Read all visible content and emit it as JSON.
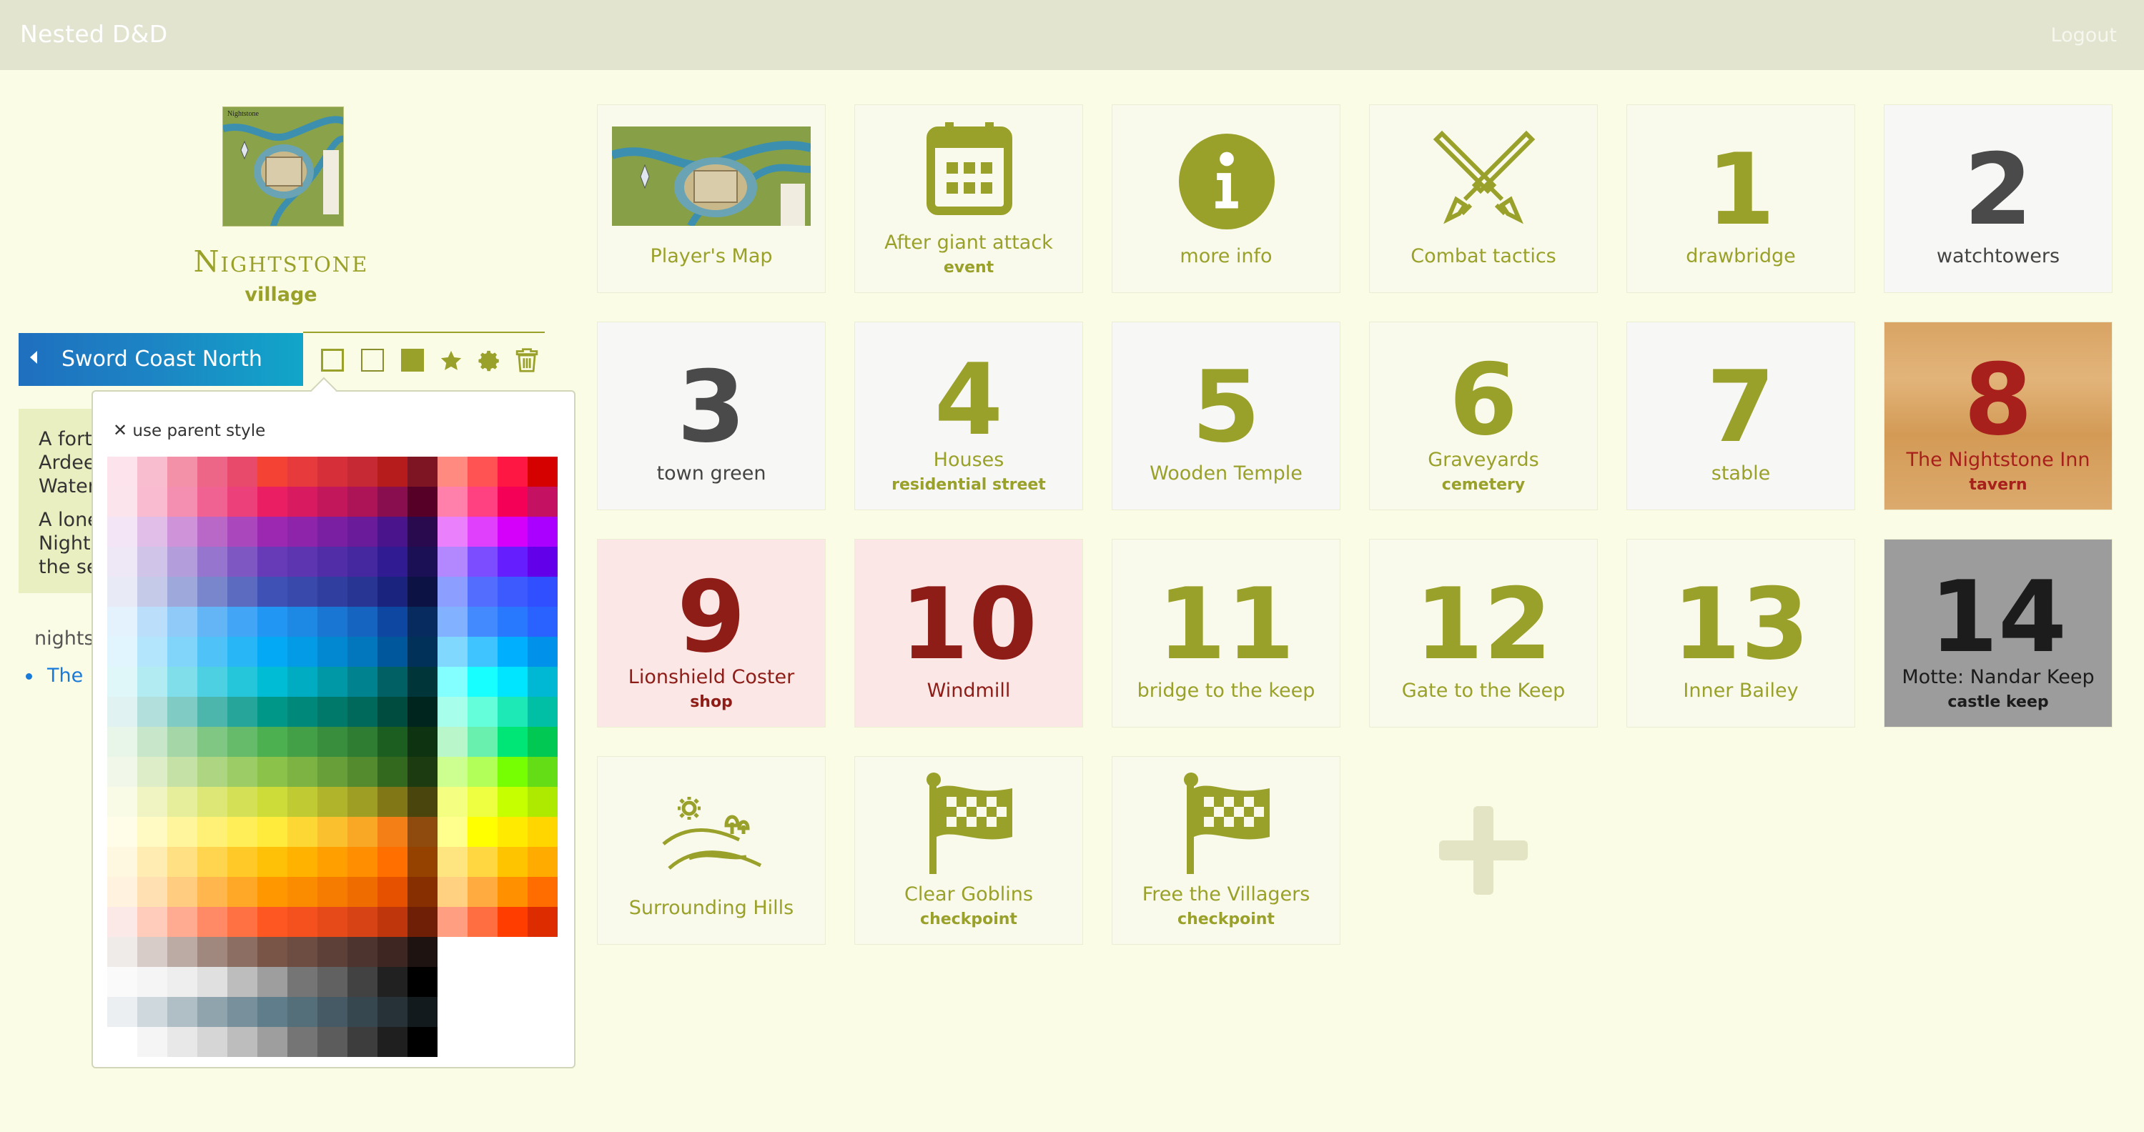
{
  "app": {
    "brand": "Nested D&D",
    "logout": "Logout"
  },
  "map": {
    "title": "Nightstone",
    "subtitle": "village",
    "thumb_text": "Nightstone"
  },
  "breadcrumb": {
    "label": "Sword Coast North"
  },
  "description": {
    "lines": [
      [
        "A forti",
        "Ardee",
        "Water"
      ],
      [
        "A lone",
        "Nights",
        "the se"
      ]
    ]
  },
  "children": {
    "label": "nightst",
    "link": "The"
  },
  "style_popup": {
    "use_parent": "use parent style"
  },
  "colors": {
    "accent": "#9aa12a",
    "link": "#1a7ad9",
    "dark_red": "#8e1c17",
    "dark_gray": "#4a4a4a"
  },
  "palette": [
    [
      "#fde4ec",
      "#f9bdd0",
      "#f391a9",
      "#ed6687",
      "#e84a6c",
      "#f44235",
      "#e63a3c",
      "#d72f3a",
      "#c62834",
      "#b71c1c",
      "#7d1622",
      "#ff8a80",
      "#ff5252",
      "#ff1744",
      "#d50000"
    ],
    [
      "#fce4ec",
      "#f8bbd0",
      "#f48fb1",
      "#f06292",
      "#ec407a",
      "#e91e63",
      "#d81b60",
      "#c2185b",
      "#ad1457",
      "#880e4f",
      "#560027",
      "#ff80ab",
      "#ff4081",
      "#f50057",
      "#c51162"
    ],
    [
      "#f3e5f5",
      "#e1bee7",
      "#ce93d8",
      "#ba68c8",
      "#ab47bc",
      "#9c27b0",
      "#8e24aa",
      "#7b1fa2",
      "#6a1b9a",
      "#4a148c",
      "#2a0a4f",
      "#ea80fc",
      "#e040fb",
      "#d500f9",
      "#aa00ff"
    ],
    [
      "#ede7f6",
      "#d1c4e9",
      "#b39ddb",
      "#9575cd",
      "#7e57c2",
      "#673ab7",
      "#5e35b1",
      "#512da8",
      "#4527a0",
      "#311b92",
      "#1b0f55",
      "#b388ff",
      "#7c4dff",
      "#651fff",
      "#6200ea"
    ],
    [
      "#e8eaf6",
      "#c5cae9",
      "#9fa8da",
      "#7986cb",
      "#5c6bc0",
      "#3f51b5",
      "#3949ab",
      "#303f9f",
      "#283593",
      "#1a237e",
      "#0d1245",
      "#8c9eff",
      "#536dfe",
      "#3d5afe",
      "#304ffe"
    ],
    [
      "#e3f2fd",
      "#bbdefb",
      "#90caf9",
      "#64b5f6",
      "#42a5f5",
      "#2196f3",
      "#1e88e5",
      "#1976d2",
      "#1565c0",
      "#0d47a1",
      "#072a5f",
      "#82b1ff",
      "#448aff",
      "#2979ff",
      "#2962ff"
    ],
    [
      "#e1f5fe",
      "#b3e5fc",
      "#81d4fa",
      "#4fc3f7",
      "#29b6f6",
      "#03a9f4",
      "#039be5",
      "#0288d1",
      "#0277bd",
      "#01579b",
      "#013058",
      "#80d8ff",
      "#40c4ff",
      "#00b0ff",
      "#0091ea"
    ],
    [
      "#e0f7fa",
      "#b2ebf2",
      "#80deea",
      "#4dd0e1",
      "#26c6da",
      "#00bcd4",
      "#00acc1",
      "#0097a7",
      "#00838f",
      "#006064",
      "#00353a",
      "#84ffff",
      "#18ffff",
      "#00e5ff",
      "#00b8d4"
    ],
    [
      "#e0f2f1",
      "#b2dfdb",
      "#80cbc4",
      "#4db6ac",
      "#26a69a",
      "#009688",
      "#00897b",
      "#00796b",
      "#00695c",
      "#004d40",
      "#00251f",
      "#a7ffeb",
      "#64ffda",
      "#1de9b6",
      "#00bfa5"
    ],
    [
      "#e8f5e9",
      "#c8e6c9",
      "#a5d6a7",
      "#81c784",
      "#66bb6a",
      "#4caf50",
      "#43a047",
      "#388e3c",
      "#2e7d32",
      "#1b5e20",
      "#0d3310",
      "#b9f6ca",
      "#69f0ae",
      "#00e676",
      "#00c853"
    ],
    [
      "#f1f8e9",
      "#dcedc8",
      "#c5e1a5",
      "#aed581",
      "#9ccc65",
      "#8bc34a",
      "#7cb342",
      "#689f38",
      "#558b2f",
      "#33691e",
      "#1c3b10",
      "#ccff90",
      "#b2ff59",
      "#76ff03",
      "#64dd17"
    ],
    [
      "#f9fbe7",
      "#f0f4c3",
      "#e6ee9c",
      "#dce775",
      "#d4e157",
      "#cddc39",
      "#c0ca33",
      "#afb42b",
      "#9e9d24",
      "#827717",
      "#4a440d",
      "#f4ff81",
      "#eeff41",
      "#c6ff00",
      "#aeea00"
    ],
    [
      "#fffde7",
      "#fff9c4",
      "#fff59d",
      "#fff176",
      "#ffee58",
      "#ffeb3b",
      "#fdd835",
      "#fbc02d",
      "#f9a825",
      "#f57f17",
      "#8f4a0d",
      "#ffff8d",
      "#ffff00",
      "#ffea00",
      "#ffd600"
    ],
    [
      "#fff8e1",
      "#ffecb3",
      "#ffe082",
      "#ffd54f",
      "#ffca28",
      "#ffc107",
      "#ffb300",
      "#ffa000",
      "#ff8f00",
      "#ff6f00",
      "#954100",
      "#ffe57f",
      "#ffd740",
      "#ffc400",
      "#ffab00"
    ],
    [
      "#fff3e0",
      "#ffe0b2",
      "#ffcc80",
      "#ffb74d",
      "#ffa726",
      "#ff9800",
      "#fb8c00",
      "#f57c00",
      "#ef6c00",
      "#e65100",
      "#872f00",
      "#ffd180",
      "#ffab40",
      "#ff9100",
      "#ff6d00"
    ],
    [
      "#fbe9e7",
      "#ffccbc",
      "#ffab91",
      "#ff8a65",
      "#ff7043",
      "#ff5722",
      "#f4511e",
      "#e64a19",
      "#d84315",
      "#bf360c",
      "#701f07",
      "#ff9e80",
      "#ff6e40",
      "#ff3d00",
      "#dd2c00"
    ],
    [
      "#efebe9",
      "#d7ccc8",
      "#bcaaa4",
      "#a1887f",
      "#8d6e63",
      "#795548",
      "#6d4c41",
      "#5d4037",
      "#4e342e",
      "#3e2723",
      "#1f1311",
      "",
      "",
      "",
      ""
    ],
    [
      "#fafafa",
      "#f5f5f5",
      "#eeeeee",
      "#e0e0e0",
      "#bdbdbd",
      "#9e9e9e",
      "#757575",
      "#616161",
      "#424242",
      "#212121",
      "#000000",
      "",
      "",
      "",
      ""
    ],
    [
      "#eceff1",
      "#cfd8dc",
      "#b0bec5",
      "#90a4ae",
      "#78909c",
      "#607d8b",
      "#546e7a",
      "#455a64",
      "#37474f",
      "#263238",
      "#131a1d",
      "",
      "",
      "",
      ""
    ],
    [
      "#ffffff",
      "#f5f5f5",
      "#e8e8e8",
      "#d6d6d6",
      "#bdbdbd",
      "#9e9e9e",
      "#757575",
      "#5c5c5c",
      "#3d3d3d",
      "#1f1f1f",
      "#000000",
      "",
      "",
      "",
      ""
    ]
  ],
  "tiles": [
    {
      "label": "Player's Map",
      "sub": "",
      "kind": "map"
    },
    {
      "label": "After giant attack",
      "sub": "event",
      "kind": "calendar-icon"
    },
    {
      "label": "more info",
      "sub": "",
      "kind": "info-icon"
    },
    {
      "label": "Combat tactics",
      "sub": "",
      "kind": "crossed-swords-icon"
    },
    {
      "num": "1",
      "label": "drawbridge",
      "sub": ""
    },
    {
      "num": "2",
      "label": "watchtowers",
      "sub": ""
    },
    {
      "num": "3",
      "label": "town green",
      "sub": ""
    },
    {
      "num": "4",
      "label": "Houses",
      "sub": "residential street"
    },
    {
      "num": "5",
      "label": "Wooden Temple",
      "sub": ""
    },
    {
      "num": "6",
      "label": "Graveyards",
      "sub": "cemetery"
    },
    {
      "num": "7",
      "label": "stable",
      "sub": ""
    },
    {
      "num": "8",
      "label": "The Nightstone Inn",
      "sub": "tavern"
    },
    {
      "num": "9",
      "label": "Lionshield Coster",
      "sub": "shop"
    },
    {
      "num": "10",
      "label": "Windmill",
      "sub": ""
    },
    {
      "num": "11",
      "label": "bridge to the keep",
      "sub": ""
    },
    {
      "num": "12",
      "label": "Gate to the Keep",
      "sub": ""
    },
    {
      "num": "13",
      "label": "Inner Bailey",
      "sub": ""
    },
    {
      "num": "14",
      "label": "Motte: Nandar Keep",
      "sub": "castle keep"
    },
    {
      "label": "Surrounding Hills",
      "sub": "",
      "kind": "hills-icon"
    },
    {
      "label": "Clear Goblins",
      "sub": "checkpoint",
      "kind": "checkered-flag-icon"
    },
    {
      "label": "Free the Villagers",
      "sub": "checkpoint",
      "kind": "checkered-flag-icon"
    }
  ]
}
